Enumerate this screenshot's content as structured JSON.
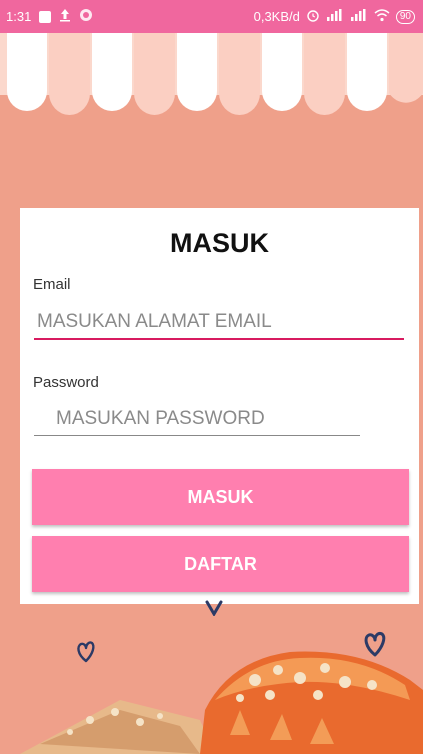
{
  "status_bar": {
    "time": "1:31",
    "net_speed": "0,3KB/d",
    "battery": "90",
    "bg_color": "#F0679E"
  },
  "background_color": "#EFA08A",
  "login": {
    "title": "MASUK",
    "email_label": "Email",
    "email_placeholder": "MASUKAN ALAMAT EMAIL",
    "password_label": "Password",
    "password_placeholder": "MASUKAN PASSWORD",
    "login_button": "MASUK",
    "register_button": "DAFTAR",
    "button_color": "#FF7FAF",
    "focus_color": "#D81B60"
  },
  "icons": [
    "image-icon",
    "upload-icon",
    "app-icon",
    "alarm-icon",
    "signal-icon",
    "wifi-icon",
    "battery-icon",
    "heart-doodle-icon",
    "cake-image"
  ]
}
